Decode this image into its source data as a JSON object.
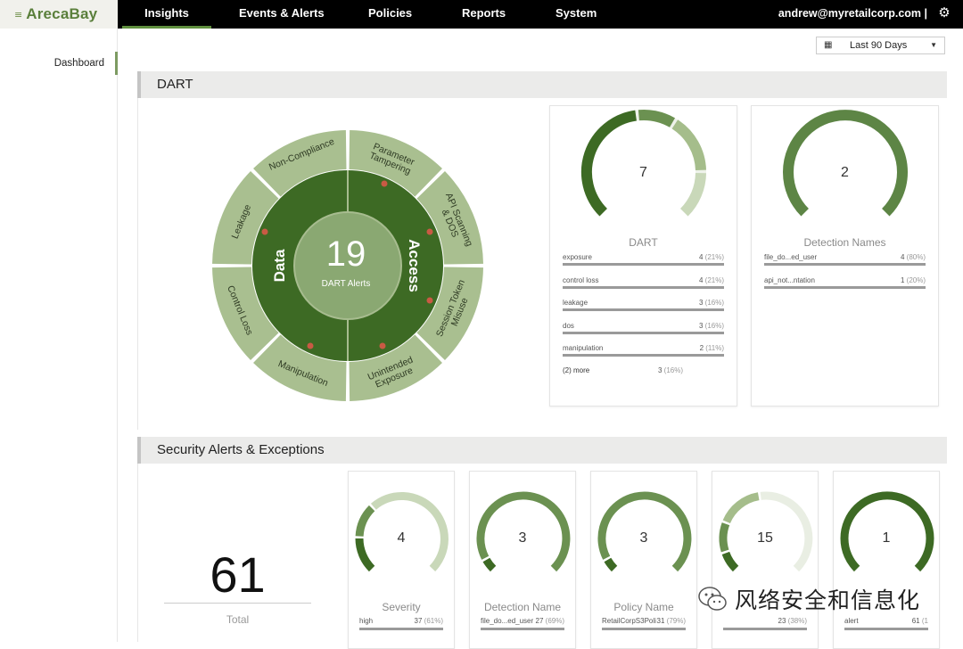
{
  "app": {
    "logo_mark": "≡",
    "logo": "ArecaBay"
  },
  "nav": [
    {
      "label": "Insights"
    },
    {
      "label": "Events & Alerts"
    },
    {
      "label": "Policies"
    },
    {
      "label": "Reports"
    },
    {
      "label": "System"
    }
  ],
  "user": {
    "email": "andrew@myretailcorp.com |"
  },
  "sidebar": {
    "items": [
      {
        "label": "Dashboard"
      }
    ]
  },
  "date_filter": {
    "value": "Last 90 Days"
  },
  "dart": {
    "title": "DART",
    "wheel": {
      "total": "19",
      "total_label": "DART Alerts",
      "left_label": "Data",
      "right_label": "Access",
      "outer_segments": [
        "Parameter Tampering",
        "API Scanning & DOS",
        "Session Token Misuse",
        "Unintended Exposure",
        "Manipulation",
        "Control Loss",
        "Leakage",
        "Non-Compliance"
      ]
    },
    "card1": {
      "value": "7",
      "title": "DART",
      "rows": [
        {
          "name": "exposure",
          "count": "4",
          "pct": "(21%)",
          "fraction": 0.21
        },
        {
          "name": "control loss",
          "count": "4",
          "pct": "(21%)",
          "fraction": 0.21
        },
        {
          "name": "leakage",
          "count": "3",
          "pct": "(16%)",
          "fraction": 0.16
        },
        {
          "name": "dos",
          "count": "3",
          "pct": "(16%)",
          "fraction": 0.16
        },
        {
          "name": "manipulation",
          "count": "2",
          "pct": "(11%)",
          "fraction": 0.11
        }
      ],
      "more": {
        "name": "(2) more",
        "count": "3",
        "pct": "(16%)"
      }
    },
    "card2": {
      "value": "2",
      "title": "Detection Names",
      "rows": [
        {
          "name": "file_do...ed_user",
          "count": "4",
          "pct": "(80%)",
          "fraction": 0.8
        },
        {
          "name": "api_not...ntation",
          "count": "1",
          "pct": "(20%)",
          "fraction": 0.2
        }
      ]
    }
  },
  "security": {
    "title": "Security Alerts & Exceptions",
    "total": "61",
    "total_label": "Total",
    "cards": [
      {
        "value": "4",
        "title": "Severity",
        "row_name": "high",
        "row_count": "37",
        "row_pct": "(61%)"
      },
      {
        "value": "3",
        "title": "Detection Name",
        "row_name": "file_do...ed_user",
        "row_count": "27",
        "row_pct": "(69%)"
      },
      {
        "value": "3",
        "title": "Policy Name",
        "row_name": "RetailCorpS3Poli",
        "row_count": "31",
        "row_pct": "(79%)"
      },
      {
        "value": "15",
        "title": "",
        "row_name": "",
        "row_count": "23",
        "row_pct": "(38%)"
      },
      {
        "value": "1",
        "title": "",
        "row_name": "alert",
        "row_count": "61",
        "row_pct": "(1"
      }
    ]
  },
  "watermark": {
    "text": "风络安全和信息化"
  },
  "colors": {
    "dark_green": "#3d6a24",
    "mid_green": "#6b9151",
    "light_green": "#a5bd8b",
    "pale_green": "#c9d8b9",
    "track": "#e9eee3"
  }
}
